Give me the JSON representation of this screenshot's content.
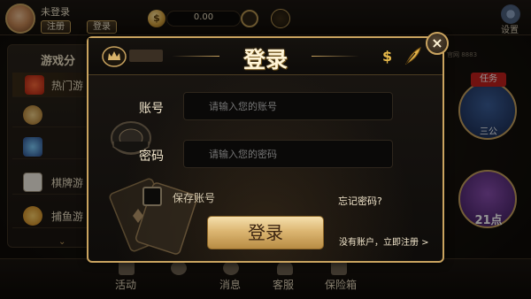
{
  "topbar": {
    "user_status": "未登录",
    "register_btn": "注册",
    "login_btn": "登录",
    "balance": "0.00",
    "settings_label": "设置"
  },
  "sidebar": {
    "title": "游戏分",
    "items": [
      {
        "label": "热门游",
        "icon": "hot-icon"
      },
      {
        "label": "",
        "icon": "chip-icon"
      },
      {
        "label": "",
        "icon": "slot-icon"
      },
      {
        "label": "棋牌游",
        "icon": "cards-icon"
      },
      {
        "label": "捕鱼游",
        "icon": "fish-icon"
      }
    ]
  },
  "bottom_nav": {
    "items": [
      {
        "label": "活动",
        "icon": "gift-icon"
      },
      {
        "label": "",
        "icon": "dollar-icon"
      },
      {
        "label": "消息",
        "icon": "message-icon"
      },
      {
        "label": "客服",
        "icon": "support-icon"
      },
      {
        "label": "保险箱",
        "icon": "safe-icon"
      }
    ]
  },
  "right_panel": {
    "task_label": "任务",
    "game_1": "三公",
    "game_2": "21点",
    "site_text": "官网 8883"
  },
  "login_modal": {
    "title": "登录",
    "account_label": "账号",
    "account_placeholder": "请输入您的账号",
    "password_label": "密码",
    "password_placeholder": "请输入您的密码",
    "remember_label": "保存账号",
    "remember_checked": false,
    "forgot_password": "忘记密码?",
    "submit_label": "登录",
    "register_link": "没有账户，立即注册 >",
    "close_symbol": "×"
  },
  "colors": {
    "gold": "#c9a35f",
    "button_gold": "#dcb672",
    "panel_dark": "#0e0c0a",
    "text_light": "#f2e6cc",
    "placeholder": "#8d8472"
  }
}
